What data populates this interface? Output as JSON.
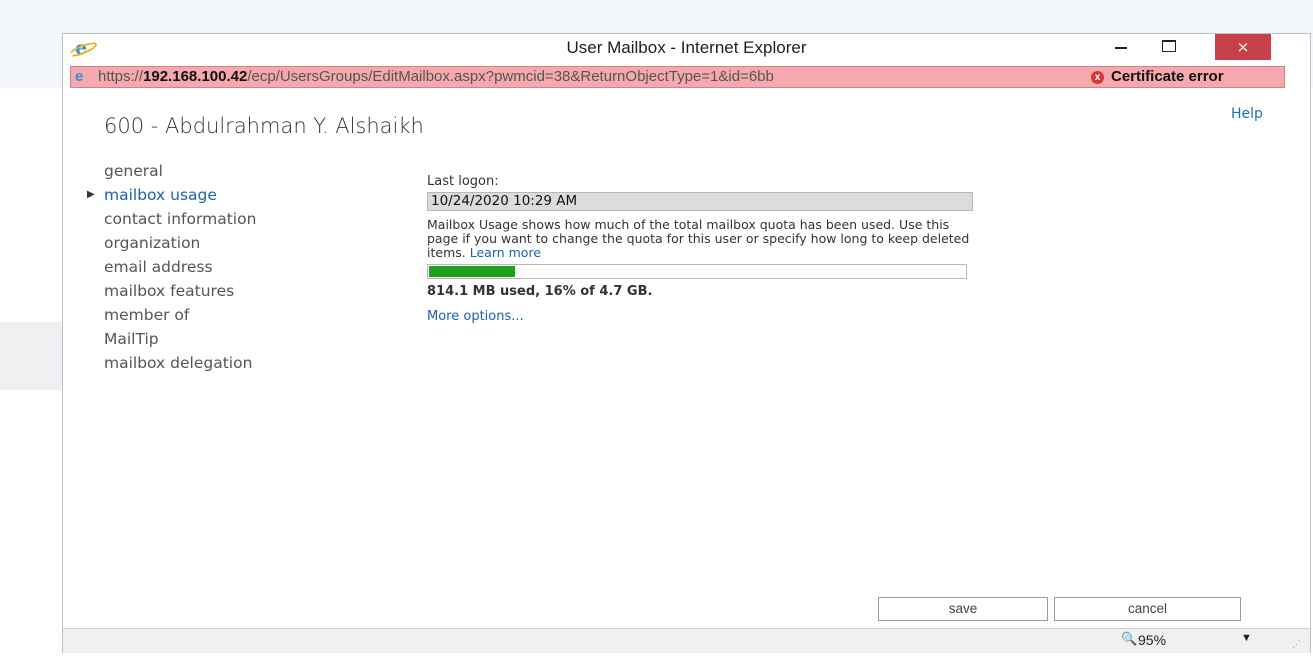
{
  "window": {
    "title": "User Mailbox - Internet Explorer",
    "close_glyph": "×"
  },
  "address_bar": {
    "url_prefix": "https://",
    "url_host": "192.168.100.42",
    "url_path": "/ecp/UsersGroups/EditMailbox.aspx?pwmcid=38&ReturnObjectType=1&id=6bb",
    "cert_error": "Certificate error",
    "cert_icon_glyph": "x"
  },
  "help_link": "Help",
  "page_title": "600 - Abdulrahman Y. Alshaikh",
  "nav": {
    "items": [
      {
        "label": "general",
        "active": false
      },
      {
        "label": "mailbox usage",
        "active": true
      },
      {
        "label": "contact information",
        "active": false
      },
      {
        "label": "organization",
        "active": false
      },
      {
        "label": "email address",
        "active": false
      },
      {
        "label": "mailbox features",
        "active": false
      },
      {
        "label": "member of",
        "active": false
      },
      {
        "label": "MailTip",
        "active": false
      },
      {
        "label": "mailbox delegation",
        "active": false
      }
    ]
  },
  "mailbox_usage": {
    "last_logon_label": "Last logon:",
    "last_logon_value": "10/24/2020 10:29 AM",
    "description": "Mailbox Usage shows how much of the total mailbox quota has been used. Use this page if you want to change the quota for this user or specify how long to keep deleted items.",
    "learn_more": "Learn more",
    "usage_percent": 16,
    "usage_text": "814.1 MB used, 16% of 4.7 GB.",
    "more_options": "More options..."
  },
  "buttons": {
    "save": "save",
    "cancel": "cancel"
  },
  "status_bar": {
    "zoom": "95%"
  },
  "colors": {
    "accent": "#1a63b0",
    "progress": "#1fa01f",
    "cert_bar": "#f5a9ae",
    "close_button": "#c84048"
  }
}
